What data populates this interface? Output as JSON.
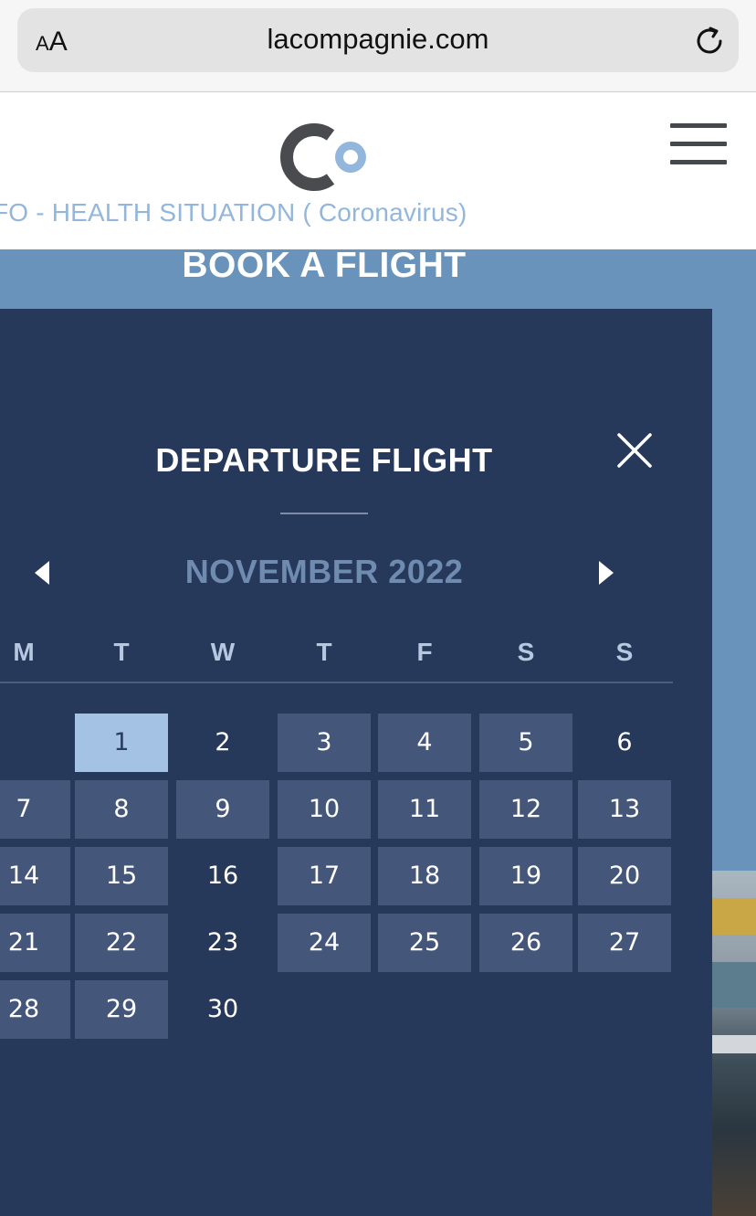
{
  "browser": {
    "text_size_small": "A",
    "text_size_large": "A",
    "url": "lacompagnie.com",
    "reload_icon": "reload-icon"
  },
  "site": {
    "logo_icon": "lacompagnie-logo",
    "menu_icon": "hamburger-menu-icon",
    "health_info": "IFO - HEALTH SITUATION ( Coronavirus)",
    "book_heading": "BOOK A FLIGHT"
  },
  "calendar": {
    "title": "DEPARTURE FLIGHT",
    "close_icon": "close-icon",
    "prev_icon": "prev-month-icon",
    "next_icon": "next-month-icon",
    "month_label": "NOVEMBER 2022",
    "weekdays": [
      "M",
      "T",
      "W",
      "T",
      "F",
      "S",
      "S"
    ],
    "selected_day": "1",
    "weeks": [
      [
        "",
        "1",
        "2",
        "3",
        "4",
        "5",
        "6"
      ],
      [
        "7",
        "8",
        "9",
        "10",
        "11",
        "12",
        "13"
      ],
      [
        "14",
        "15",
        "16",
        "17",
        "18",
        "19",
        "20"
      ],
      [
        "21",
        "22",
        "23",
        "24",
        "25",
        "26",
        "27"
      ],
      [
        "28",
        "29",
        "30",
        "",
        "",
        "",
        ""
      ]
    ],
    "unavailable_days": [
      "2",
      "6",
      "16",
      "23",
      "30"
    ]
  },
  "colors": {
    "panel": "#27395b",
    "day_box": "#44577a",
    "selected": "#a3c2e4",
    "month_label": "#6f8bb0",
    "health_info": "#93b6dc",
    "hero": "#6a93bc"
  }
}
